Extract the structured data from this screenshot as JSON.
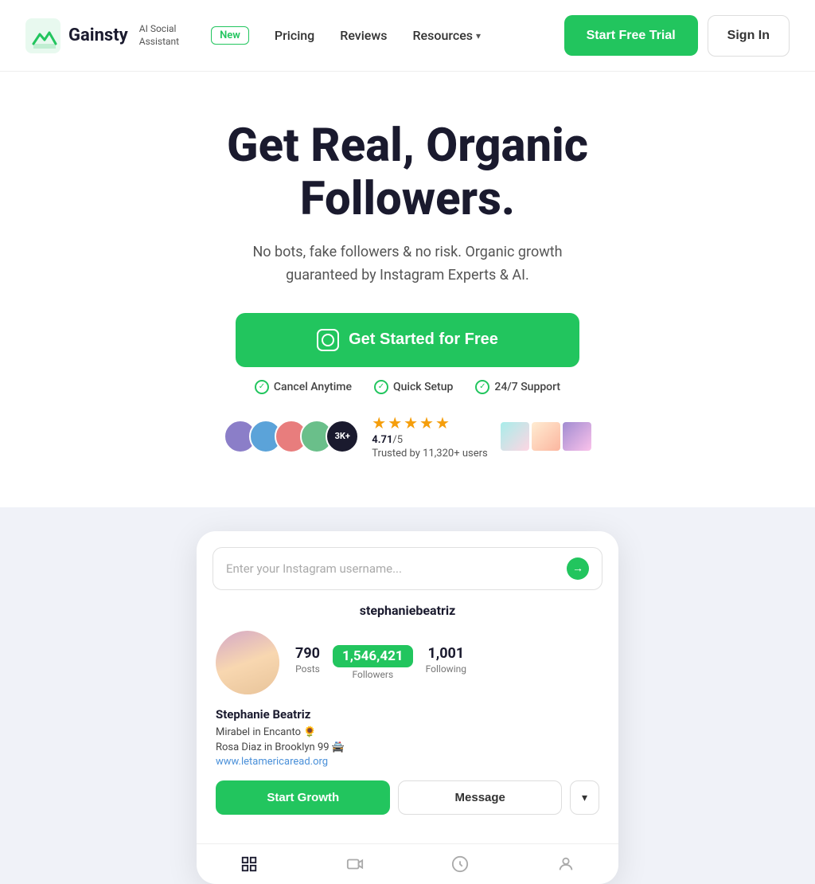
{
  "nav": {
    "logo_text": "Gainsty",
    "ai_label_line1": "AI Social",
    "ai_label_line2": "Assistant",
    "new_badge": "New",
    "links": [
      {
        "label": "Pricing",
        "id": "pricing"
      },
      {
        "label": "Reviews",
        "id": "reviews"
      },
      {
        "label": "Resources",
        "id": "resources"
      }
    ],
    "start_trial_btn": "Start Free Trial",
    "sign_in_btn": "Sign In"
  },
  "hero": {
    "headline_line1": "Get Real, Organic",
    "headline_line2": "Followers.",
    "subtext": "No bots, fake followers & no risk. Organic growth guaranteed by Instagram Experts & AI.",
    "cta_button": "Get Started for Free",
    "trust": [
      {
        "label": "Cancel Anytime"
      },
      {
        "label": "Quick Setup"
      },
      {
        "label": "24/7 Support"
      }
    ],
    "rating": "4.71",
    "rating_denom": "/5",
    "trusted_text": "Trusted by 11,320+ users",
    "avatar_count": "3K+"
  },
  "profile_card": {
    "search_placeholder": "Enter your Instagram username...",
    "username": "stephaniebeatriz",
    "posts_count": "790",
    "posts_label": "Posts",
    "followers_count": "1,546,421",
    "followers_label": "Followers",
    "following_count": "1,001",
    "following_label": "Following",
    "bio_name": "Stephanie Beatriz",
    "bio_line1": "Mirabel in Encanto 🌻",
    "bio_line2": "Rosa Diaz in Brooklyn 99 🚔",
    "bio_link": "www.letamericaread.org",
    "start_growth_btn": "Start Growth",
    "message_btn": "Message"
  }
}
